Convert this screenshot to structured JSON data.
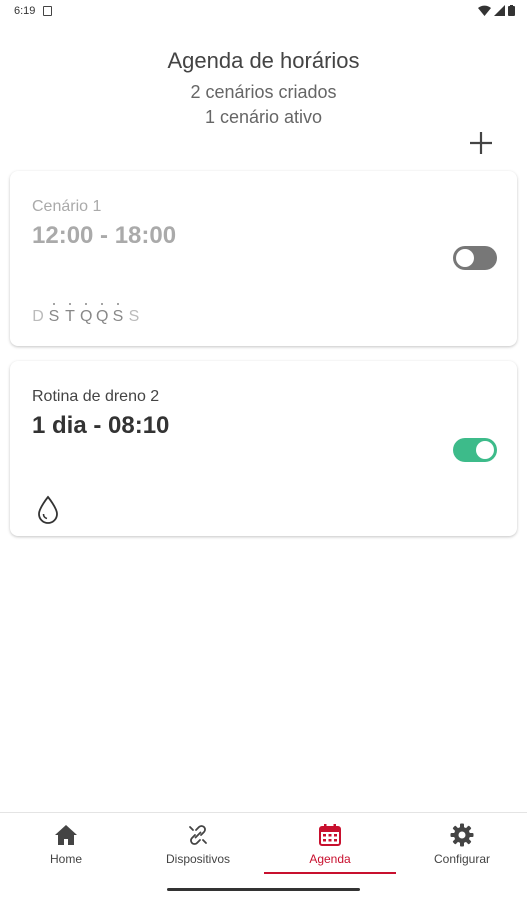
{
  "status_bar": {
    "time": "6:19"
  },
  "header": {
    "title": "Agenda de horários",
    "subtitle_created": "2 cenários criados",
    "subtitle_active": "1 cenário ativo"
  },
  "scenarios": [
    {
      "name": "Cenário 1",
      "time": "12:00 - 18:00",
      "enabled": false,
      "days": [
        {
          "letter": "D",
          "selected": false
        },
        {
          "letter": "S",
          "selected": true
        },
        {
          "letter": "T",
          "selected": true
        },
        {
          "letter": "Q",
          "selected": true
        },
        {
          "letter": "Q",
          "selected": true
        },
        {
          "letter": "S",
          "selected": true
        },
        {
          "letter": "S",
          "selected": false
        }
      ]
    },
    {
      "name": "Rotina de dreno 2",
      "time": "1 dia - 08:10",
      "enabled": true,
      "icon": "water-drop-icon"
    }
  ],
  "nav": {
    "items": [
      {
        "label": "Home",
        "icon": "home-icon",
        "active": false
      },
      {
        "label": "Dispositivos",
        "icon": "link-off-icon",
        "active": false
      },
      {
        "label": "Agenda",
        "icon": "calendar-icon",
        "active": true
      },
      {
        "label": "Configurar",
        "icon": "gear-icon",
        "active": false
      }
    ]
  },
  "colors": {
    "accent": "#c8102e",
    "toggle_on": "#3dbb8a",
    "toggle_off": "#777777"
  }
}
